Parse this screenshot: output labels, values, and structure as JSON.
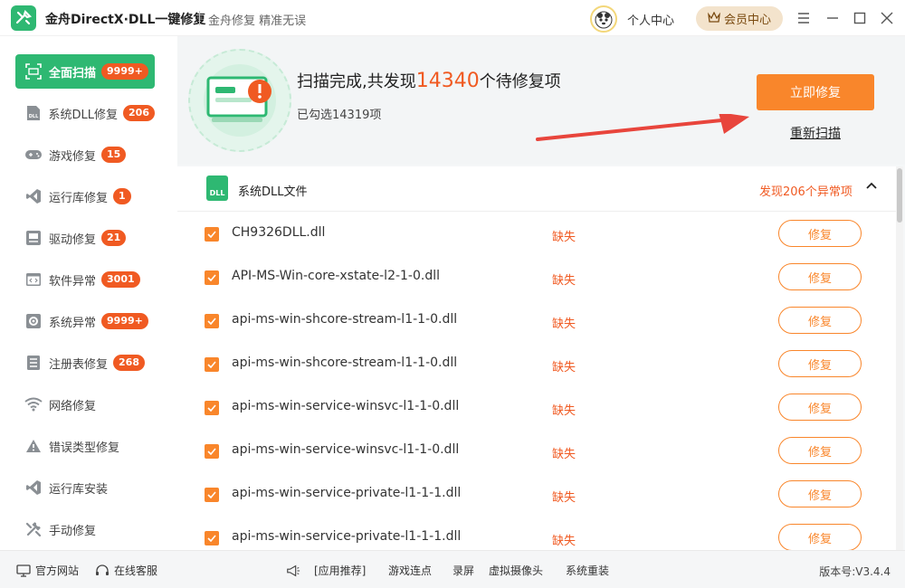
{
  "app": {
    "title": "金舟DirectX·DLL一键修复",
    "slogan": "金舟修复 精准无误",
    "personal_center": "个人中心",
    "vip_center": "会员中心",
    "colors": {
      "primary_green": "#2eb872",
      "accent_orange": "#f9862b",
      "alert_red": "#f05a22"
    }
  },
  "sidebar": {
    "items": [
      {
        "label": "全面扫描",
        "badge": "9999+",
        "icon": "scan-icon"
      },
      {
        "label": "系统DLL修复",
        "badge": "206",
        "icon": "dll-icon"
      },
      {
        "label": "游戏修复",
        "badge": "15",
        "icon": "gamepad-icon"
      },
      {
        "label": "运行库修复",
        "badge": "1",
        "icon": "visual-studio-icon"
      },
      {
        "label": "驱动修复",
        "badge": "21",
        "icon": "driver-icon"
      },
      {
        "label": "软件异常",
        "badge": "3001",
        "icon": "code-window-icon"
      },
      {
        "label": "系统异常",
        "badge": "9999+",
        "icon": "gear-icon"
      },
      {
        "label": "注册表修复",
        "badge": "268",
        "icon": "list-icon"
      },
      {
        "label": "网络修复",
        "badge": "",
        "icon": "wifi-icon"
      },
      {
        "label": "错误类型修复",
        "badge": "",
        "icon": "warning-icon"
      },
      {
        "label": "运行库安装",
        "badge": "",
        "icon": "visual-studio-icon"
      },
      {
        "label": "手动修复",
        "badge": "",
        "icon": "wrench-icon"
      }
    ]
  },
  "scan": {
    "title_prefix": "扫描完成,共发现",
    "count": "14340",
    "title_suffix": "个待修复项",
    "selected": "已勾选14319项",
    "fix_now": "立即修复",
    "rescan": "重新扫描"
  },
  "group": {
    "icon_label": "DLL",
    "title": "系统DLL文件",
    "found": "发现206个异常项"
  },
  "files": [
    {
      "name": "CH9326DLL.dll",
      "status": "缺失",
      "action": "修复"
    },
    {
      "name": "API-MS-Win-core-xstate-l2-1-0.dll",
      "status": "缺失",
      "action": "修复"
    },
    {
      "name": "api-ms-win-shcore-stream-l1-1-0.dll",
      "status": "缺失",
      "action": "修复"
    },
    {
      "name": "api-ms-win-shcore-stream-l1-1-0.dll",
      "status": "缺失",
      "action": "修复"
    },
    {
      "name": "api-ms-win-service-winsvc-l1-1-0.dll",
      "status": "缺失",
      "action": "修复"
    },
    {
      "name": "api-ms-win-service-winsvc-l1-1-0.dll",
      "status": "缺失",
      "action": "修复"
    },
    {
      "name": "api-ms-win-service-private-l1-1-1.dll",
      "status": "缺失",
      "action": "修复"
    },
    {
      "name": "api-ms-win-service-private-l1-1-1.dll",
      "status": "缺失",
      "action": "修复"
    }
  ],
  "footer": {
    "official_site": "官方网站",
    "online_service": "在线客服",
    "recommend": "[应用推荐]",
    "links": [
      "游戏连点",
      "录屏",
      "虚拟摄像头",
      "系统重装"
    ],
    "version": "版本号:V3.4.4"
  }
}
